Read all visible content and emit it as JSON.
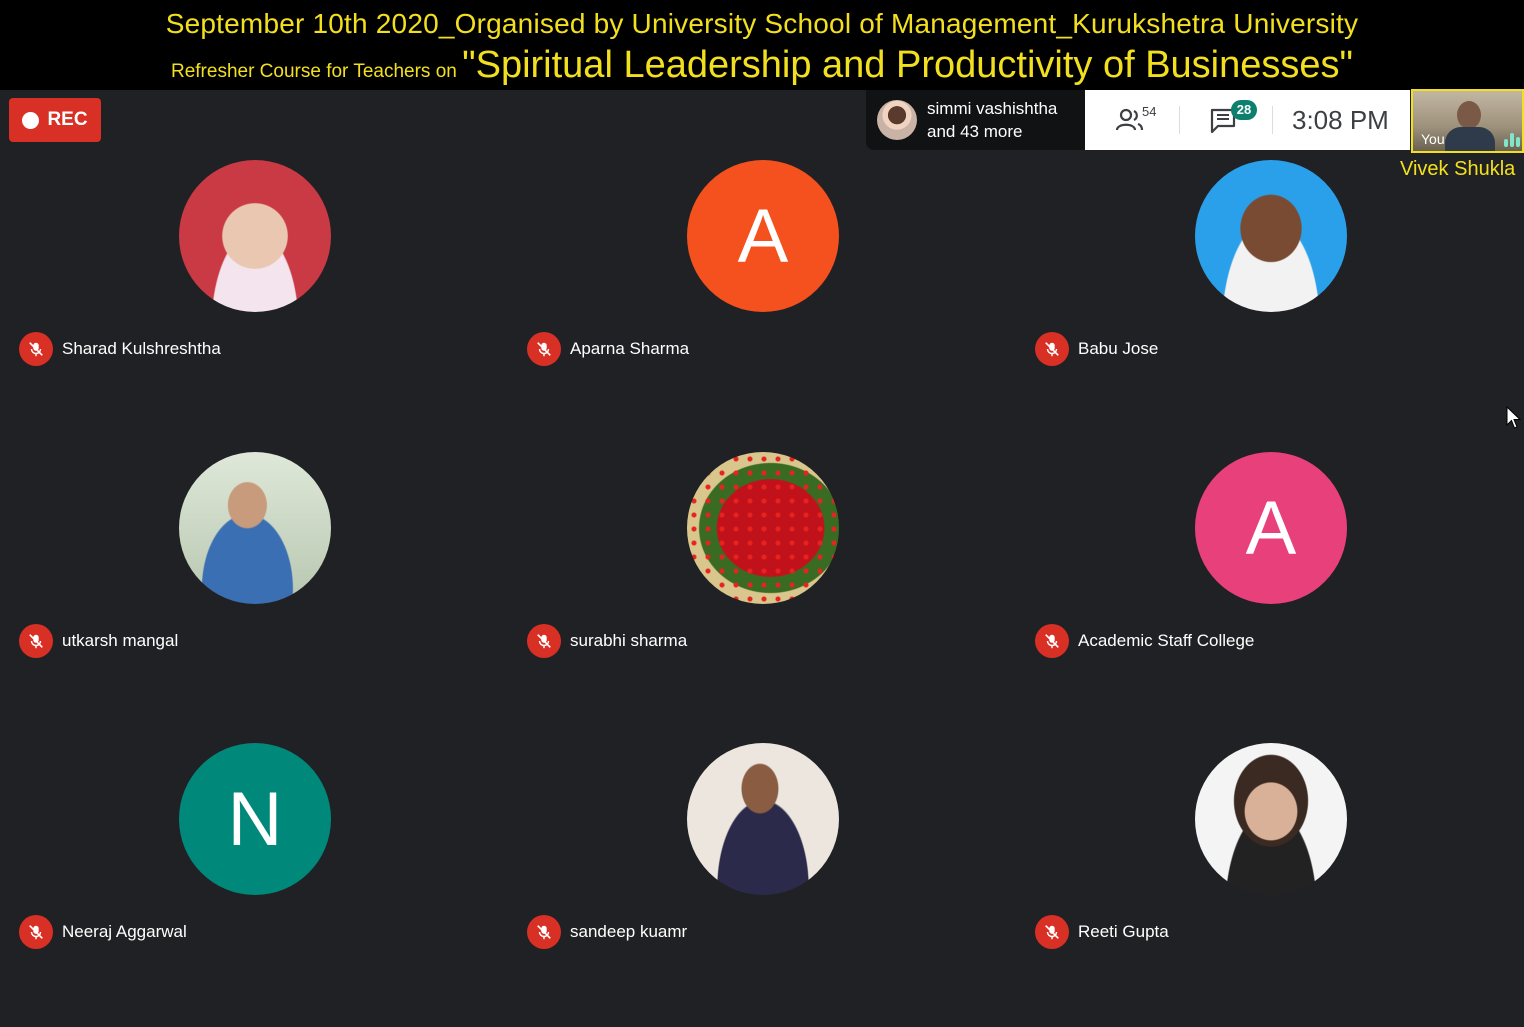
{
  "banner": {
    "line1": "September 10th 2020_Organised by University School of Management_Kurukshetra University",
    "line2_small": "Refresher Course for Teachers  on ",
    "line2_big": "\"Spiritual Leadership and Productivity of Businesses\""
  },
  "recording": {
    "label": "REC"
  },
  "presenting": {
    "name": "simmi vashishtha",
    "more": "and 43 more"
  },
  "topbar": {
    "people_count": "54",
    "chat_count": "28",
    "time": "3:08 PM"
  },
  "self": {
    "label": "You",
    "name": "Vivek Shukla"
  },
  "colors": {
    "banner_text": "#f2e01f",
    "mic_off": "#d93025",
    "avatar_orange": "#f4511e",
    "avatar_pink": "#e8407a",
    "avatar_teal": "#00897b"
  },
  "participants": [
    {
      "name": "Sharad Kulshreshtha",
      "avatar_type": "photo",
      "initial": ""
    },
    {
      "name": "Aparna Sharma",
      "avatar_type": "initial",
      "initial": "A"
    },
    {
      "name": "Babu Jose",
      "avatar_type": "photo",
      "initial": ""
    },
    {
      "name": "utkarsh mangal",
      "avatar_type": "photo",
      "initial": ""
    },
    {
      "name": "surabhi sharma",
      "avatar_type": "photo",
      "initial": ""
    },
    {
      "name": "Academic Staff College",
      "avatar_type": "initial",
      "initial": "A"
    },
    {
      "name": "Neeraj Aggarwal",
      "avatar_type": "initial",
      "initial": "N"
    },
    {
      "name": "sandeep kuamr",
      "avatar_type": "photo",
      "initial": ""
    },
    {
      "name": "Reeti Gupta",
      "avatar_type": "photo",
      "initial": ""
    }
  ],
  "icons": {
    "mic": "mic-off-icon",
    "people": "people-icon",
    "chat": "chat-icon",
    "cursor": "mouse-pointer-icon"
  }
}
